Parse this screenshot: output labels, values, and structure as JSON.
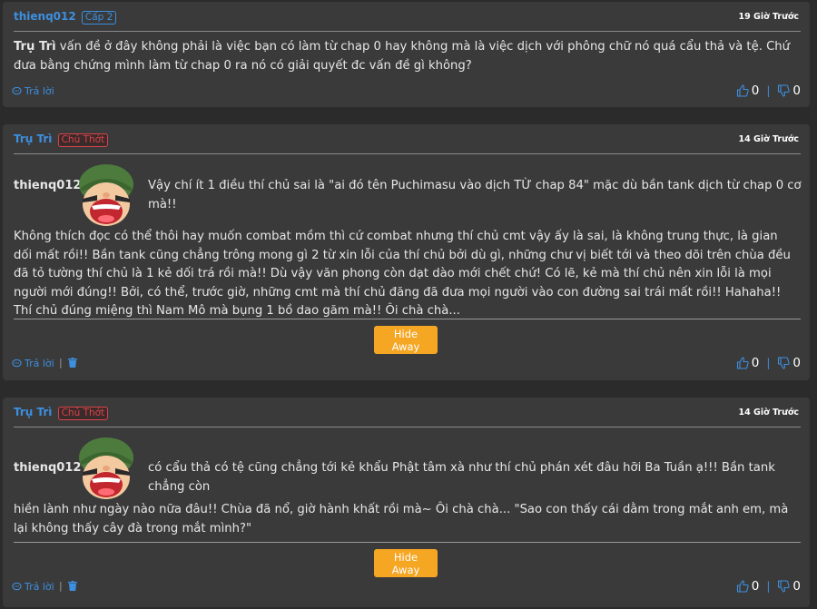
{
  "comments": [
    {
      "user": "thienq012",
      "badge": "Cấp 2",
      "time": "19 Giờ Trước",
      "mention": "Trụ Trì",
      "text": " vấn đề ở đây không phải là việc bạn có làm từ chap 0 hay không mà là việc dịch với phông chữ nó quá cẩu thả và tệ. Chứ đưa bằng chứng mình làm từ chap 0 ra nó có giải quyết đc vấn đề gì không?",
      "reply_label": "Trả lời",
      "likes": "0",
      "dislikes": "0"
    },
    {
      "user": "Trụ Trì",
      "badge": "Chủ Thớt",
      "time": "14 Giờ Trước",
      "quote_user": "thienq012",
      "quote_text": "Vậy chí ít 1 điều thí chủ sai là \"ai đó tên Puchimasu vào dịch TỪ chap 84\" mặc dù bần tank dịch từ chap 0 cơ mà!!",
      "text": "Không thích đọc có thể thôi hay muốn combat mồm thì cứ combat nhưng thí chủ cmt vậy ấy là sai, là không trung thực, là gian dối mất rồi!! Bần tank cũng chẳng trông mong gì 2 từ xin lỗi của thí chủ bởi dù gì, những chư vị biết tới và theo dõi trên chùa đều đã tỏ tường thí chủ là 1 kẻ dối trá rồi mà!! Dù vậy văn phong còn dạt dào mới chết chứ! Có lẽ, kẻ mà thí chủ nên xin lỗi là mọi người mới đúng!! Bởi, có thể, trước giờ, những cmt mà thí chủ đăng đã đưa mọi người vào con đường sai trái mất rồi!! Hahaha!! Thí chủ đúng miệng thì Nam Mô mà bụng 1 bồ dao găm mà!! Ôi chà chà...",
      "hide_label": "Hide Away",
      "reply_label": "Trả lời",
      "likes": "0",
      "dislikes": "0"
    },
    {
      "user": "Trụ Trì",
      "badge": "Chủ Thớt",
      "time": "14 Giờ Trước",
      "quote_user": "thienq012",
      "quote_text": "có cẩu thả có tệ cũng chẳng tới kẻ khẩu Phật tâm xà như thí chủ phán xét đâu hỡi Ba Tuần ạ!!! Bần tank chẳng còn",
      "text": "hiền lành như ngày nào nữa đâu!! Chùa đã nổ, giờ hành khất rồi mà~ Ôi chà chà... \"Sao con thấy cái dằm trong mắt anh em, mà lại không thấy cây đà trong mắt mình?\"",
      "hide_label": "Hide Away",
      "reply_label": "Trả lời",
      "likes": "0",
      "dislikes": "0"
    }
  ],
  "colors": {
    "accent": "#3d8fe0",
    "owner": "#d9434a",
    "button": "#f5a623"
  },
  "icons": {
    "reply": "chat-bubble-icon",
    "delete": "trash-icon",
    "like": "thumbs-up-icon",
    "dislike": "thumbs-down-icon"
  }
}
